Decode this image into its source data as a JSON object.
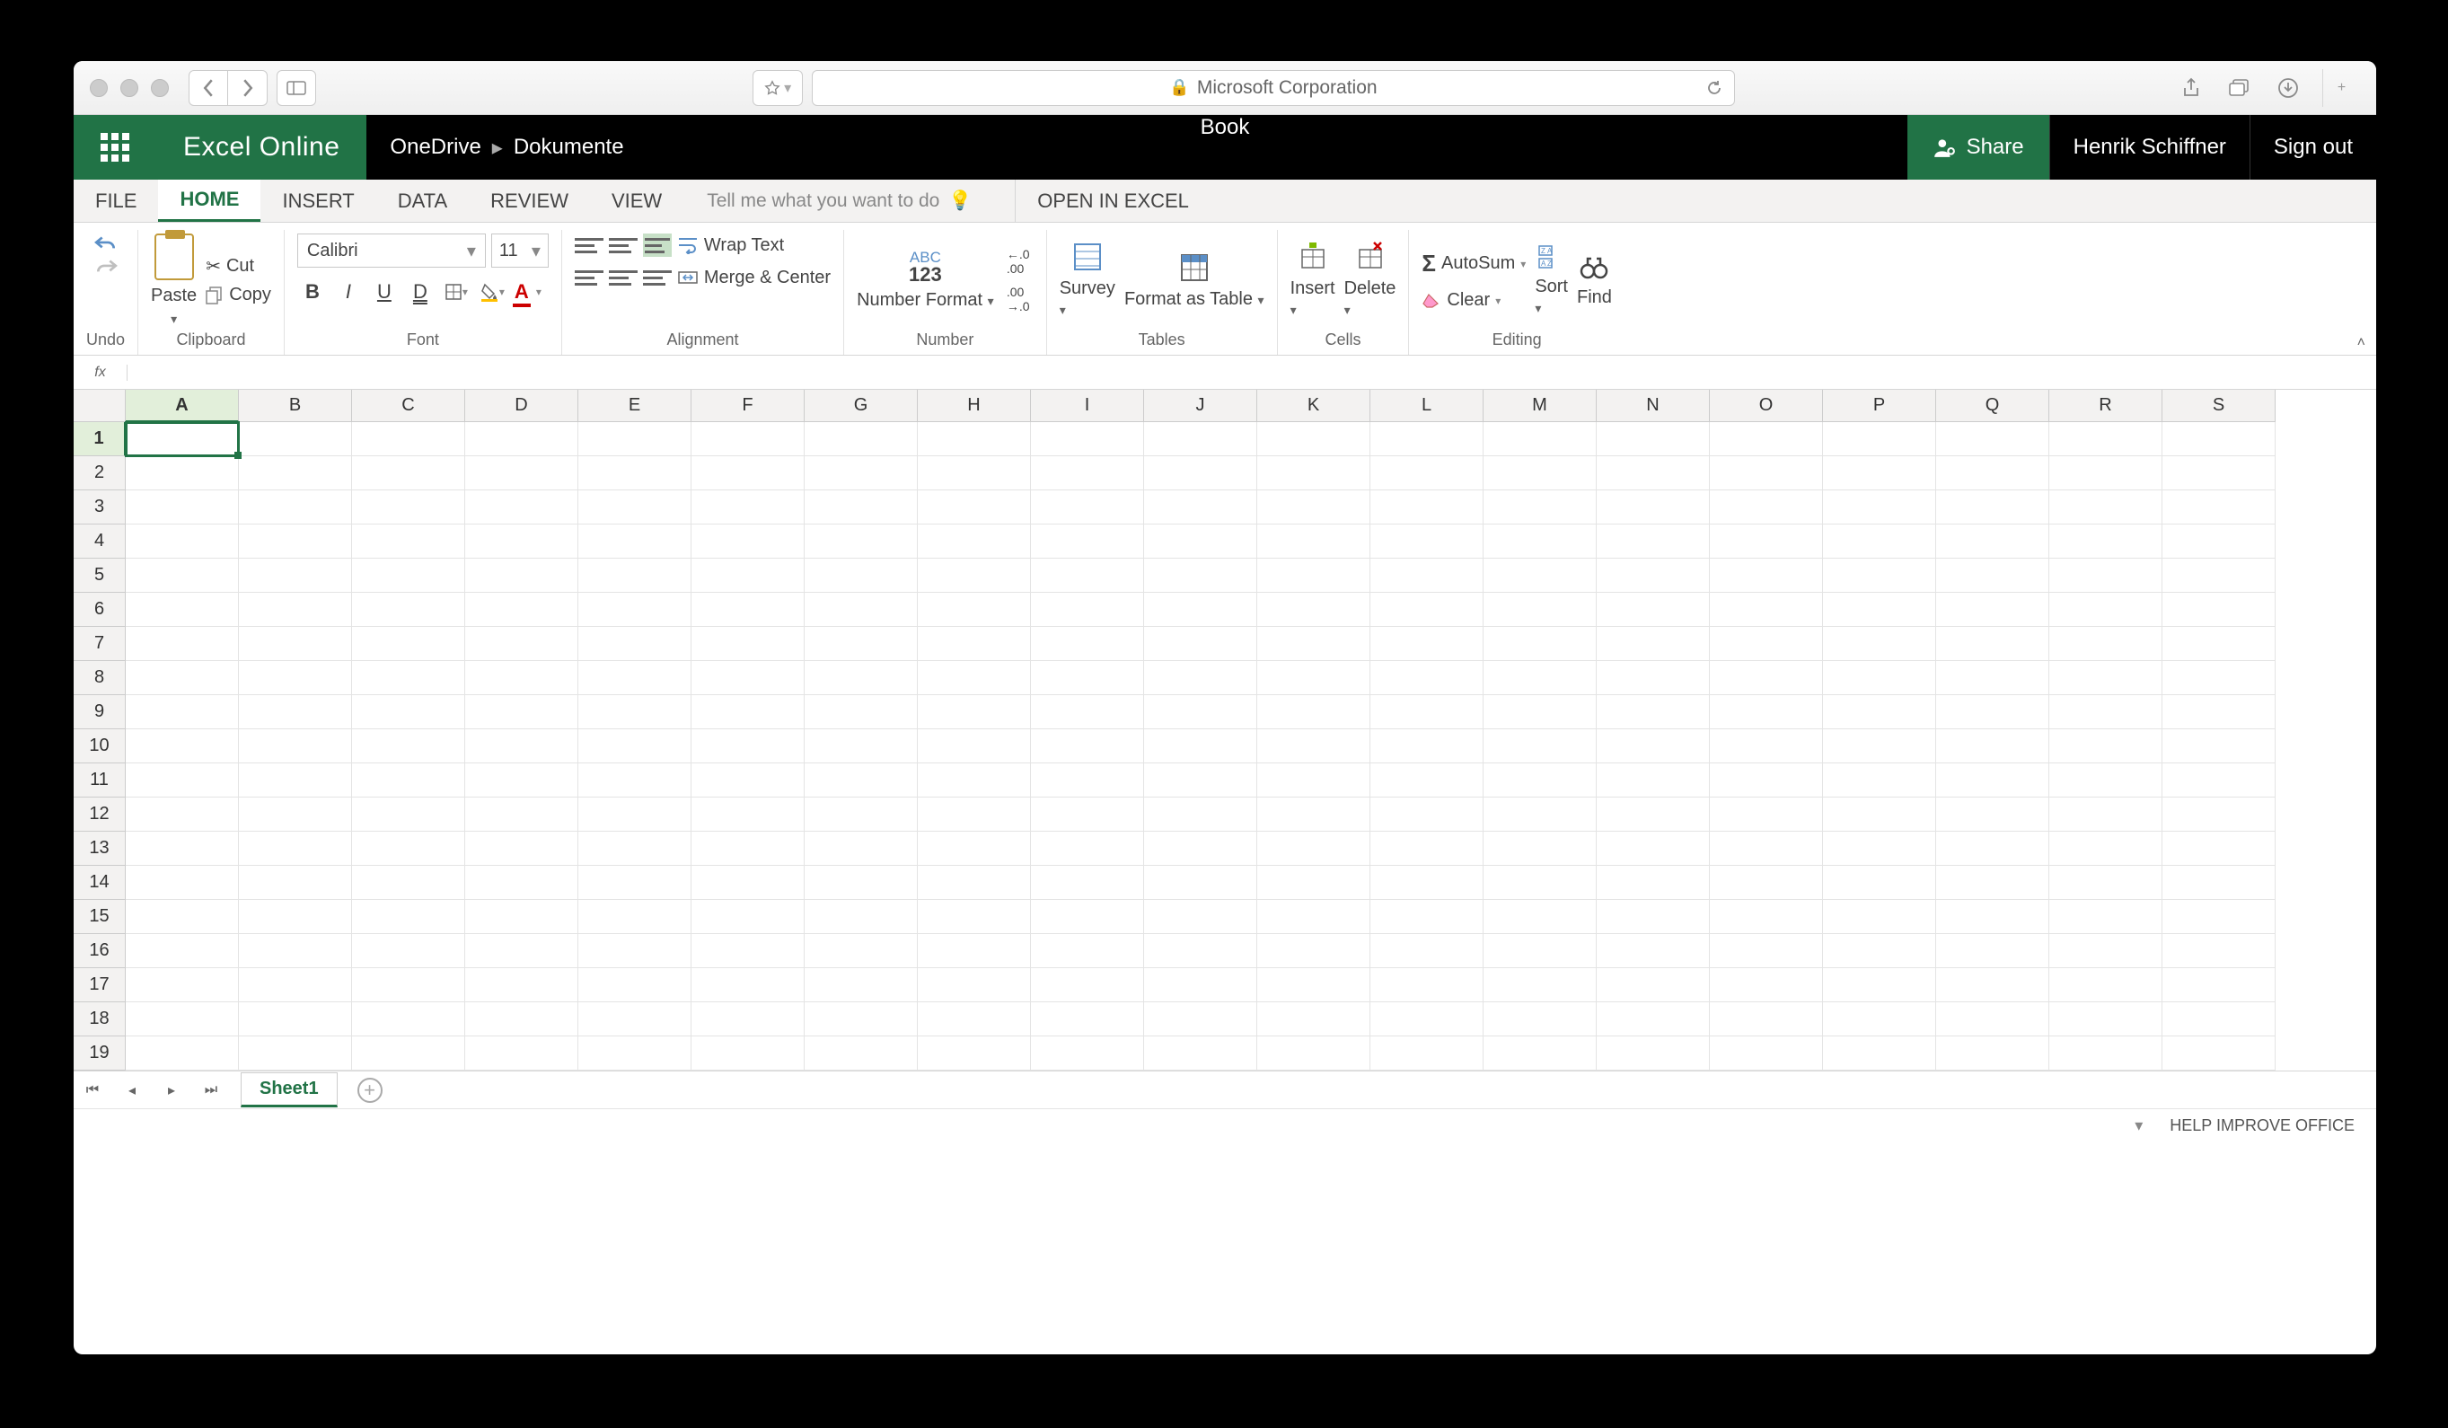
{
  "safari": {
    "address_text": "Microsoft Corporation"
  },
  "header": {
    "brand": "Excel Online",
    "breadcrumb": [
      "OneDrive",
      "Dokumente"
    ],
    "doc_title": "Book",
    "share": "Share",
    "user": "Henrik Schiffner",
    "sign_out": "Sign out"
  },
  "tabs": {
    "items": [
      "FILE",
      "HOME",
      "INSERT",
      "DATA",
      "REVIEW",
      "VIEW"
    ],
    "active_index": 1,
    "tell_me_placeholder": "Tell me what you want to do",
    "open_in_excel": "OPEN IN EXCEL"
  },
  "ribbon": {
    "undo": {
      "label": "Undo"
    },
    "clipboard": {
      "label": "Clipboard",
      "paste": "Paste",
      "cut": "Cut",
      "copy": "Copy"
    },
    "font": {
      "label": "Font",
      "name": "Calibri",
      "size": "11"
    },
    "alignment": {
      "label": "Alignment",
      "wrap": "Wrap Text",
      "merge": "Merge & Center"
    },
    "number": {
      "label": "Number",
      "format": "Number Format"
    },
    "tables": {
      "label": "Tables",
      "survey": "Survey",
      "format_table": "Format as Table"
    },
    "cells": {
      "label": "Cells",
      "insert": "Insert",
      "delete": "Delete"
    },
    "editing": {
      "label": "Editing",
      "autosum": "AutoSum",
      "clear": "Clear",
      "sort": "Sort",
      "find": "Find"
    }
  },
  "formula_bar": {
    "fx": "fx",
    "value": ""
  },
  "grid": {
    "columns": [
      "A",
      "B",
      "C",
      "D",
      "E",
      "F",
      "G",
      "H",
      "I",
      "J",
      "K",
      "L",
      "M",
      "N",
      "O",
      "P",
      "Q",
      "R",
      "S"
    ],
    "rows": [
      1,
      2,
      3,
      4,
      5,
      6,
      7,
      8,
      9,
      10,
      11,
      12,
      13,
      14,
      15,
      16,
      17,
      18,
      19
    ],
    "selected_col": "A",
    "selected_row": 1
  },
  "sheets": {
    "active": "Sheet1"
  },
  "status": {
    "help": "HELP IMPROVE OFFICE"
  }
}
